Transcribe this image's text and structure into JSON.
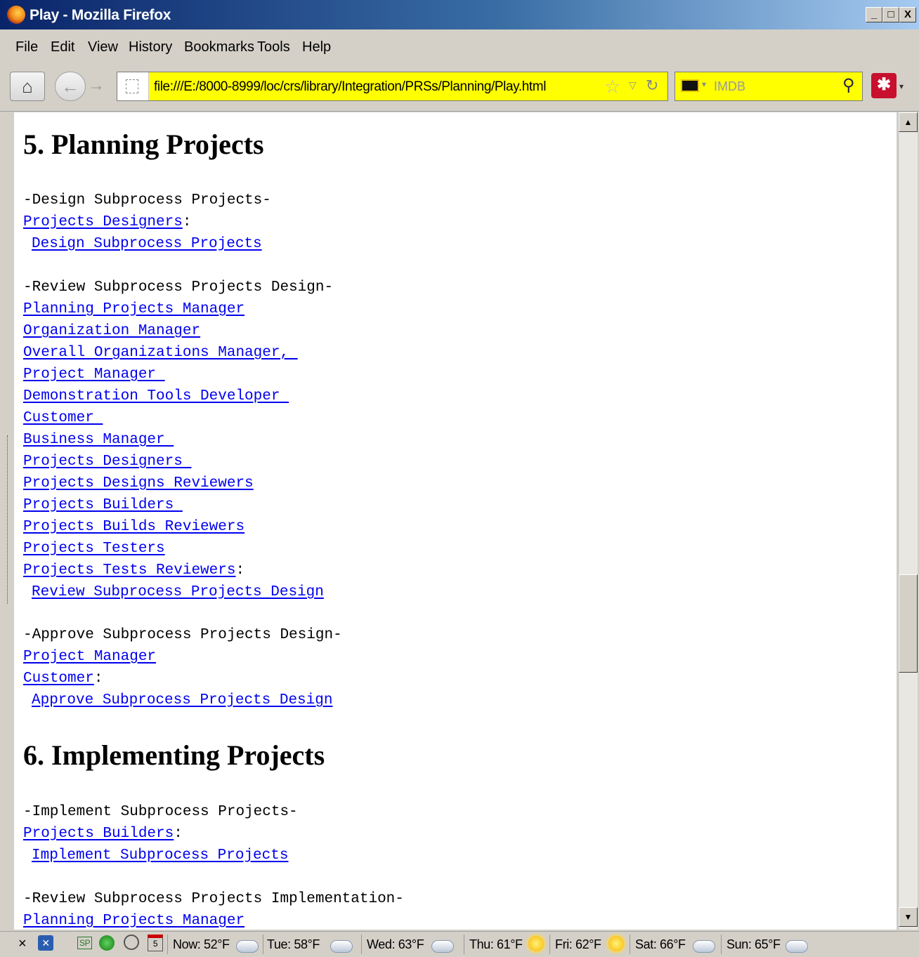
{
  "window": {
    "title": "Play - Mozilla Firefox",
    "min_label": "_",
    "max_label": "□",
    "close_label": "X"
  },
  "menu": {
    "file": "File",
    "edit": "Edit",
    "view": "View",
    "history": "History",
    "bookmarks": "Bookmarks",
    "tools": "Tools",
    "help": "Help"
  },
  "toolbar": {
    "url": "file:///E:/8000-8999/loc/crs/library/Integration/PRSs/Planning/Play.html",
    "search_placeholder": "IMDB",
    "home_icon": "home-icon",
    "back_icon": "back-arrow-icon",
    "forward_icon": "forward-arrow-icon"
  },
  "page": {
    "sections": [
      {
        "title": "5. Planning Projects",
        "groups": [
          {
            "heading": "-Design Subprocess Projects-",
            "roles": [
              "Projects Designers"
            ],
            "action": "Design Subprocess Projects"
          },
          {
            "heading": "-Review Subprocess Projects Design-",
            "roles": [
              "Planning Projects Manager",
              "Organization Manager",
              "Overall Organizations Manager, ",
              "Project Manager ",
              "Demonstration Tools Developer ",
              "Customer ",
              "Business Manager ",
              "Projects Designers ",
              "Projects Designs Reviewers",
              "Projects Builders ",
              "Projects Builds Reviewers",
              "Projects Testers",
              "Projects Tests Reviewers"
            ],
            "action": "Review Subprocess Projects Design"
          },
          {
            "heading": "-Approve Subprocess Projects Design-",
            "roles": [
              "Project Manager",
              "Customer"
            ],
            "action": "Approve Subprocess Projects Design"
          }
        ]
      },
      {
        "title": "6. Implementing Projects",
        "groups": [
          {
            "heading": "-Implement Subprocess Projects-",
            "roles": [
              "Projects Builders"
            ],
            "action": "Implement Subprocess Projects"
          },
          {
            "heading": "-Review Subprocess Projects Implementation-",
            "roles": [
              "Planning Projects Manager"
            ]
          }
        ]
      }
    ],
    "colon": ":"
  },
  "statusbar": {
    "close_label": "×",
    "sp_label": "SP",
    "calendar_day": "5",
    "weather": [
      {
        "label": "Now: 52°F",
        "icon": "cloud"
      },
      {
        "label": "Tue: 58°F",
        "icon": "cloud"
      },
      {
        "label": "Wed: 63°F",
        "icon": "cloud"
      },
      {
        "label": "Thu: 61°F",
        "icon": "sun"
      },
      {
        "label": "Fri: 62°F",
        "icon": "sun"
      },
      {
        "label": "Sat: 66°F",
        "icon": "cloud"
      },
      {
        "label": "Sun: 65°F",
        "icon": "cloud"
      }
    ]
  },
  "colors": {
    "link": "#0000ee",
    "urlbar_bg": "#ffff00",
    "titlebar_start": "#0a246a"
  }
}
